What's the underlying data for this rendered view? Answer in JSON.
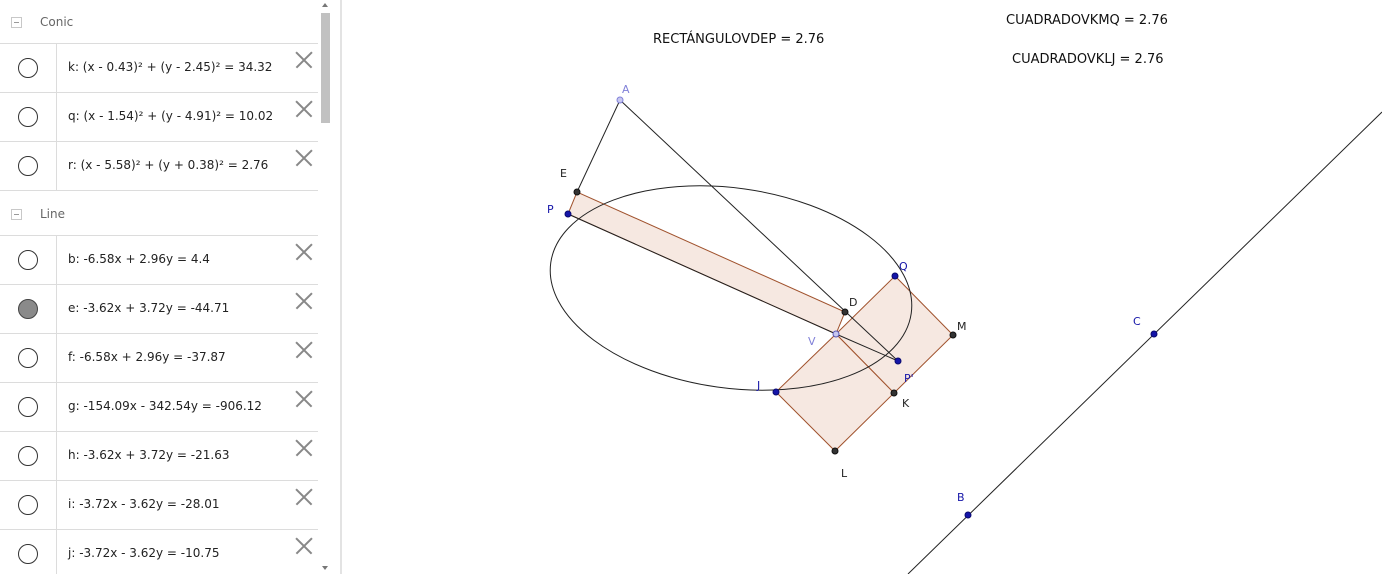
{
  "algebra": {
    "groups": [
      {
        "label": "Conic",
        "items": [
          {
            "formula": "k: (x - 0.43)² + (y - 2.45)² = 34.32",
            "visible": false
          },
          {
            "formula": "q: (x - 1.54)² + (y - 4.91)² = 10.02",
            "visible": false
          },
          {
            "formula": "r: (x - 5.58)² + (y + 0.38)² = 2.76",
            "visible": false
          }
        ]
      },
      {
        "label": "Line",
        "items": [
          {
            "formula": "b: -6.58x + 2.96y = 4.4",
            "visible": false
          },
          {
            "formula": "e: -3.62x + 3.72y = -44.71",
            "visible": true
          },
          {
            "formula": "f: -6.58x + 2.96y = -37.87",
            "visible": false
          },
          {
            "formula": "g: -154.09x - 342.54y = -906.12",
            "visible": false
          },
          {
            "formula": "h: -3.62x + 3.72y = -21.63",
            "visible": false
          },
          {
            "formula": "i: -3.72x - 3.62y = -28.01",
            "visible": false
          },
          {
            "formula": "j: -3.72x - 3.62y = -10.75",
            "visible": false
          }
        ]
      }
    ]
  },
  "graphics": {
    "measures": {
      "rect": "RECTÁNGULOVDEP = 2.76",
      "sq1": "CUADRADOVKMQ = 2.76",
      "sq2": "CUADRADOVKLJ = 2.76"
    },
    "points": {
      "A": "A",
      "E": "E",
      "P": "P",
      "D": "D",
      "Q": "Q",
      "M": "M",
      "V": "V",
      "J": "J",
      "P2": "P'",
      "K": "K",
      "L": "L",
      "C": "C",
      "B": "B"
    },
    "colors": {
      "fill": "#f5e4dc",
      "polygon_stroke": "#a0522d",
      "free_point": "#1515a8",
      "dependent_point": "#333333",
      "light_point": "#8080d8"
    }
  }
}
